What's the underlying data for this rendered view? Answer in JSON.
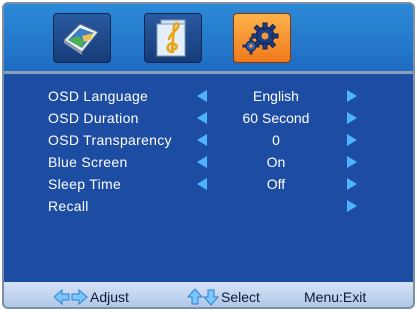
{
  "tabs": [
    {
      "name": "picture-icon"
    },
    {
      "name": "sound-icon"
    },
    {
      "name": "settings-icon",
      "active": true
    }
  ],
  "menu": [
    {
      "label": "OSD  Language",
      "value": "English"
    },
    {
      "label": "OSD  Duration",
      "value": "60  Second"
    },
    {
      "label": "OSD  Transparency",
      "value": "0"
    },
    {
      "label": "Blue  Screen",
      "value": "On"
    },
    {
      "label": "Sleep  Time",
      "value": "Off"
    },
    {
      "label": "Recall",
      "value": ""
    }
  ],
  "footer": {
    "adjust_label": "Adjust",
    "select_label": "Select",
    "menu_label": "Menu:Exit"
  },
  "colors": {
    "background": "#1d4da3",
    "arrow": "#4fb3ff",
    "active_tab": "#f59a30"
  }
}
